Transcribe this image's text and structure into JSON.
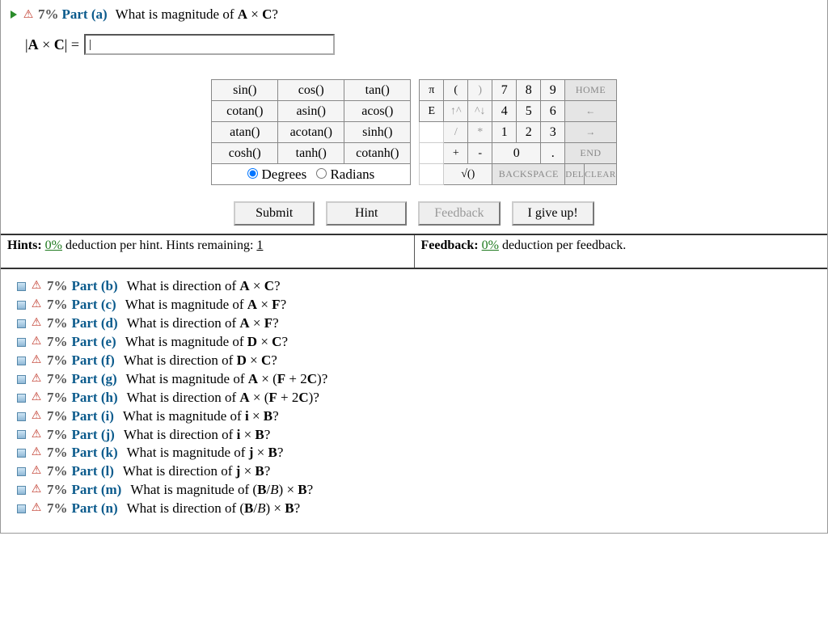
{
  "active_part": {
    "percent": "7%",
    "label": "Part (a)",
    "question_pre": "What is magnitude of ",
    "question_vec1": "A",
    "question_op": " × ",
    "question_vec2": "C",
    "question_post": "?",
    "eq_lhs_pre": "|",
    "eq_lhs_v1": "A",
    "eq_lhs_op": " × ",
    "eq_lhs_v2": "C",
    "eq_lhs_post": "| = ",
    "input_value": "|"
  },
  "funcs": {
    "r1c1": "sin()",
    "r1c2": "cos()",
    "r1c3": "tan()",
    "r2c1": "cotan()",
    "r2c2": "asin()",
    "r2c3": "acos()",
    "r3c1": "atan()",
    "r3c2": "acotan()",
    "r3c3": "sinh()",
    "r4c1": "cosh()",
    "r4c2": "tanh()",
    "r4c3": "cotanh()",
    "degrees": "Degrees",
    "radians": "Radians"
  },
  "numpad": {
    "pi": "π",
    "lp": "(",
    "rp": ")",
    "n7": "7",
    "n8": "8",
    "n9": "9",
    "home": "HOME",
    "E": "E",
    "up": "↑^",
    "dn": "^↓",
    "n4": "4",
    "n5": "5",
    "n6": "6",
    "back_arrow": "←",
    "sl": "/",
    "st": "*",
    "n1": "1",
    "n2": "2",
    "n3": "3",
    "fwd_arrow": "→",
    "pl": "+",
    "mi": "-",
    "n0": "0",
    "dot": ".",
    "end": "END",
    "sqrt": "√()",
    "bksp": "BACKSPACE",
    "del": "DEL",
    "clear": "CLEAR"
  },
  "actions": {
    "submit": "Submit",
    "hint": "Hint",
    "feedback": "Feedback",
    "giveup": "I give up!"
  },
  "hints": {
    "label": "Hints:",
    "pct": "0%",
    "mid": "deduction per hint. Hints remaining:",
    "remain": "1"
  },
  "feedback": {
    "label": "Feedback:",
    "pct": "0%",
    "tail": "deduction per feedback."
  },
  "parts": [
    {
      "pct": "7%",
      "lbl": "Part (b)",
      "pre": "What is direction of ",
      "v1": "A",
      "op": " × ",
      "v2": "C",
      "post": "?"
    },
    {
      "pct": "7%",
      "lbl": "Part (c)",
      "pre": "What is magnitude of ",
      "v1": "A",
      "op": " × ",
      "v2": "F",
      "post": "?"
    },
    {
      "pct": "7%",
      "lbl": "Part (d)",
      "pre": "What is direction of ",
      "v1": "A",
      "op": " × ",
      "v2": "F",
      "post": "?"
    },
    {
      "pct": "7%",
      "lbl": "Part (e)",
      "pre": "What is magnitude of ",
      "v1": "D",
      "op": " × ",
      "v2": "C",
      "post": "?"
    },
    {
      "pct": "7%",
      "lbl": "Part (f)",
      "pre": "What is direction of ",
      "v1": "D",
      "op": " × ",
      "v2": "C",
      "post": "?"
    },
    {
      "pct": "7%",
      "lbl": "Part (g)",
      "pre": "What is magnitude of ",
      "v1": "A",
      "op": " × (",
      "v2": "F",
      "post": " + 2",
      "v3": "C",
      "post2": ")?"
    },
    {
      "pct": "7%",
      "lbl": "Part (h)",
      "pre": "What is direction of ",
      "v1": "A",
      "op": " × (",
      "v2": "F",
      "post": " + 2",
      "v3": "C",
      "post2": ")?"
    },
    {
      "pct": "7%",
      "lbl": "Part (i)",
      "pre": "What is magnitude of ",
      "v1": "i",
      "op": " × ",
      "v2": "B",
      "post": "?"
    },
    {
      "pct": "7%",
      "lbl": "Part (j)",
      "pre": "What is direction of ",
      "v1": "i",
      "op": " × ",
      "v2": "B",
      "post": "?"
    },
    {
      "pct": "7%",
      "lbl": "Part (k)",
      "pre": "What is magnitude of ",
      "v1": "j",
      "op": " × ",
      "v2": "B",
      "post": "?"
    },
    {
      "pct": "7%",
      "lbl": "Part (l)",
      "pre": "What is direction of ",
      "v1": "j",
      "op": " × ",
      "v2": "B",
      "post": "?"
    },
    {
      "pct": "7%",
      "lbl": "Part (m)",
      "pre": "What is magnitude of (",
      "v1": "B",
      "op": "/",
      "i1": "B",
      "post": ") × ",
      "v2": "B",
      "post2": "?"
    },
    {
      "pct": "7%",
      "lbl": "Part (n)",
      "pre": "What is direction of (",
      "v1": "B",
      "op": "/",
      "i1": "B",
      "post": ") × ",
      "v2": "B",
      "post2": "?"
    }
  ]
}
